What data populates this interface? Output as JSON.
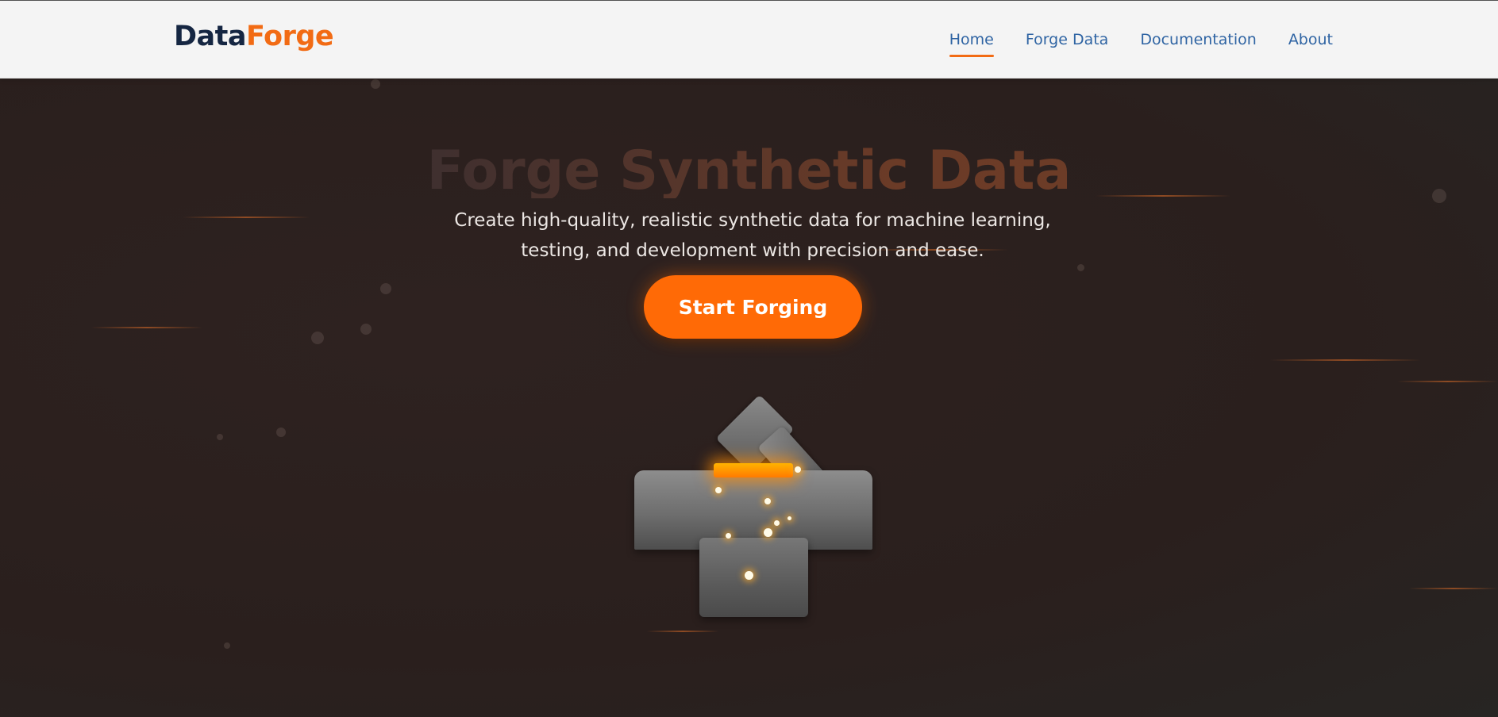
{
  "brand": {
    "part1": "Data",
    "part2": "Forge"
  },
  "nav": {
    "items": [
      {
        "label": "Home",
        "active": true
      },
      {
        "label": "Forge Data",
        "active": false
      },
      {
        "label": "Documentation",
        "active": false
      },
      {
        "label": "About",
        "active": false
      }
    ]
  },
  "hero": {
    "title": "Forge Synthetic Data",
    "subtitle": "Create high-quality, realistic synthetic data for machine learning, testing, and development with precision and ease.",
    "cta_label": "Start Forging"
  },
  "illustration": {
    "icon": "anvil-hammer-icon"
  },
  "colors": {
    "brand_dark": "#152642",
    "accent": "#f26b14",
    "cta": "#ff6a06",
    "nav_link": "#2f64a3",
    "hero_bg": "#2b201e"
  }
}
